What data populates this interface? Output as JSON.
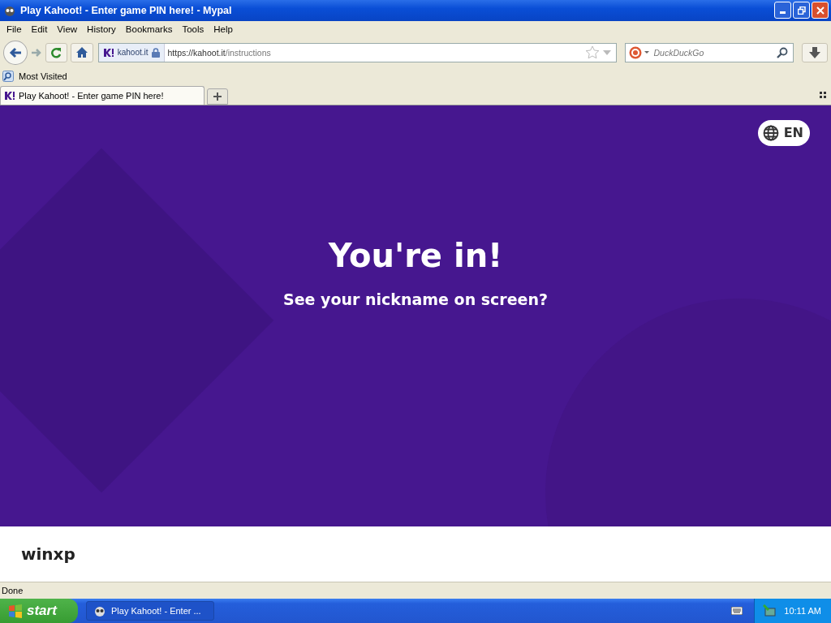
{
  "window": {
    "title": "Play Kahoot! - Enter game PIN here! - Mypal"
  },
  "menu": [
    "File",
    "Edit",
    "View",
    "History",
    "Bookmarks",
    "Tools",
    "Help"
  ],
  "address_bar": {
    "site": "kahoot.it",
    "url_host": "https://kahoot.it",
    "url_path": "/instructions"
  },
  "search": {
    "placeholder": "DuckDuckGo"
  },
  "bookmarks": [
    "Most Visited"
  ],
  "tabs": [
    {
      "label": "Play Kahoot! - Enter game PIN here!",
      "selected": true
    }
  ],
  "page": {
    "language": "EN",
    "heading": "You're in!",
    "subheading": "See your nickname on screen?",
    "nickname": "winxp"
  },
  "status_bar": "Done",
  "taskbar": {
    "start": "start",
    "tasks": [
      "Play Kahoot! - Enter ..."
    ],
    "clock": "10:11 AM"
  }
}
